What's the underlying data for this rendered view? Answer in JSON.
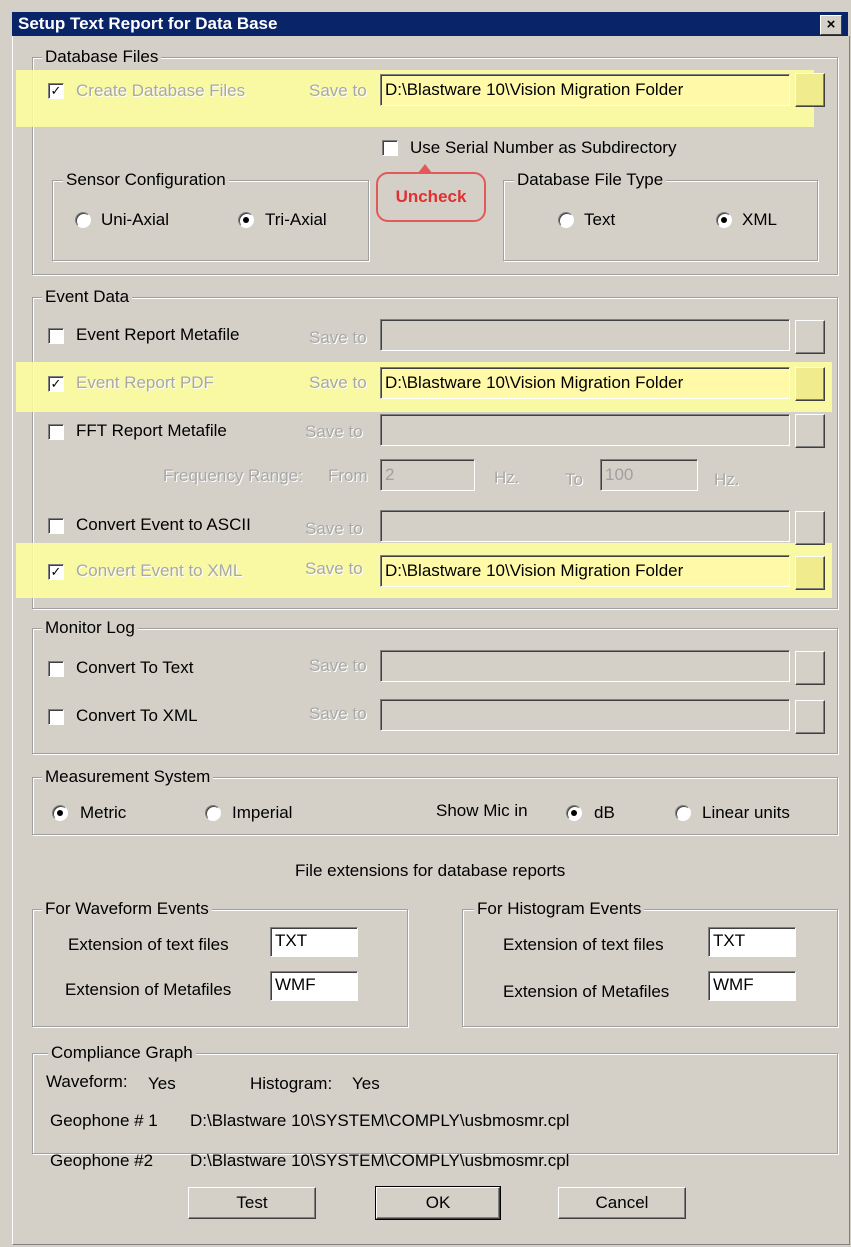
{
  "window": {
    "title": "Setup Text Report for Data Base",
    "close_glyph": "×"
  },
  "database_files": {
    "legend": "Database Files",
    "create_label": "Create Database Files",
    "create_checked": true,
    "save_to_label": "Save to",
    "path": "D:\\Blastware 10\\Vision Migration Folder",
    "serial_label": "Use Serial Number as Subdirectory",
    "serial_checked": false,
    "annotation": "Uncheck",
    "sensor": {
      "legend": "Sensor Configuration",
      "uni": "Uni-Axial",
      "tri": "Tri-Axial",
      "selected": "tri"
    },
    "filetype": {
      "legend": "Database File Type",
      "text": "Text",
      "xml": "XML",
      "selected": "xml"
    }
  },
  "event_data": {
    "legend": "Event Data",
    "save_to_label": "Save to",
    "rows": [
      {
        "label": "Event Report Metafile",
        "checked": false,
        "path": ""
      },
      {
        "label": "Event Report PDF",
        "checked": true,
        "path": "D:\\Blastware 10\\Vision Migration Folder"
      },
      {
        "label": "FFT Report Metafile",
        "checked": false,
        "path": ""
      },
      {
        "label": "Convert Event to ASCII",
        "checked": false,
        "path": ""
      },
      {
        "label": "Convert Event to XML",
        "checked": true,
        "path": "D:\\Blastware 10\\Vision Migration Folder"
      }
    ],
    "frequency": {
      "label": "Frequency Range:",
      "from_label": "From",
      "from": "2",
      "unit": "Hz.",
      "to_label": "To",
      "to": "100",
      "unit2": "Hz."
    }
  },
  "monitor_log": {
    "legend": "Monitor Log",
    "save_to_label": "Save to",
    "rows": [
      {
        "label": "Convert To Text",
        "checked": false,
        "path": ""
      },
      {
        "label": "Convert To XML",
        "checked": false,
        "path": ""
      }
    ]
  },
  "measurement": {
    "legend": "Measurement System",
    "metric": "Metric",
    "imperial": "Imperial",
    "system_selected": "metric",
    "mic_label": "Show Mic in",
    "db": "dB",
    "linear": "Linear units",
    "mic_selected": "db"
  },
  "extensions": {
    "heading": "File extensions for database reports",
    "waveform": {
      "legend": "For Waveform Events",
      "text_label": "Extension of text files",
      "text_value": "TXT",
      "meta_label": "Extension of  Metafiles",
      "meta_value": "WMF"
    },
    "histogram": {
      "legend": "For Histogram Events",
      "text_label": "Extension of text files",
      "text_value": "TXT",
      "meta_label": "Extension of  Metafiles",
      "meta_value": "WMF"
    }
  },
  "compliance": {
    "legend": "Compliance Graph",
    "waveform_label": "Waveform:",
    "waveform_value": "Yes",
    "histogram_label": "Histogram:",
    "histogram_value": "Yes",
    "geo1_label": "Geophone # 1",
    "geo1_path": "D:\\Blastware 10\\SYSTEM\\COMPLY\\usbmosmr.cpl",
    "geo2_label": "Geophone #2",
    "geo2_path": "D:\\Blastware 10\\SYSTEM\\COMPLY\\usbmosmr.cpl"
  },
  "buttons": {
    "test": "Test",
    "ok": "OK",
    "cancel": "Cancel"
  },
  "colors": {
    "titlebar": "#0a246a",
    "highlight": "#ffff9c",
    "annotation": "#e03030"
  }
}
